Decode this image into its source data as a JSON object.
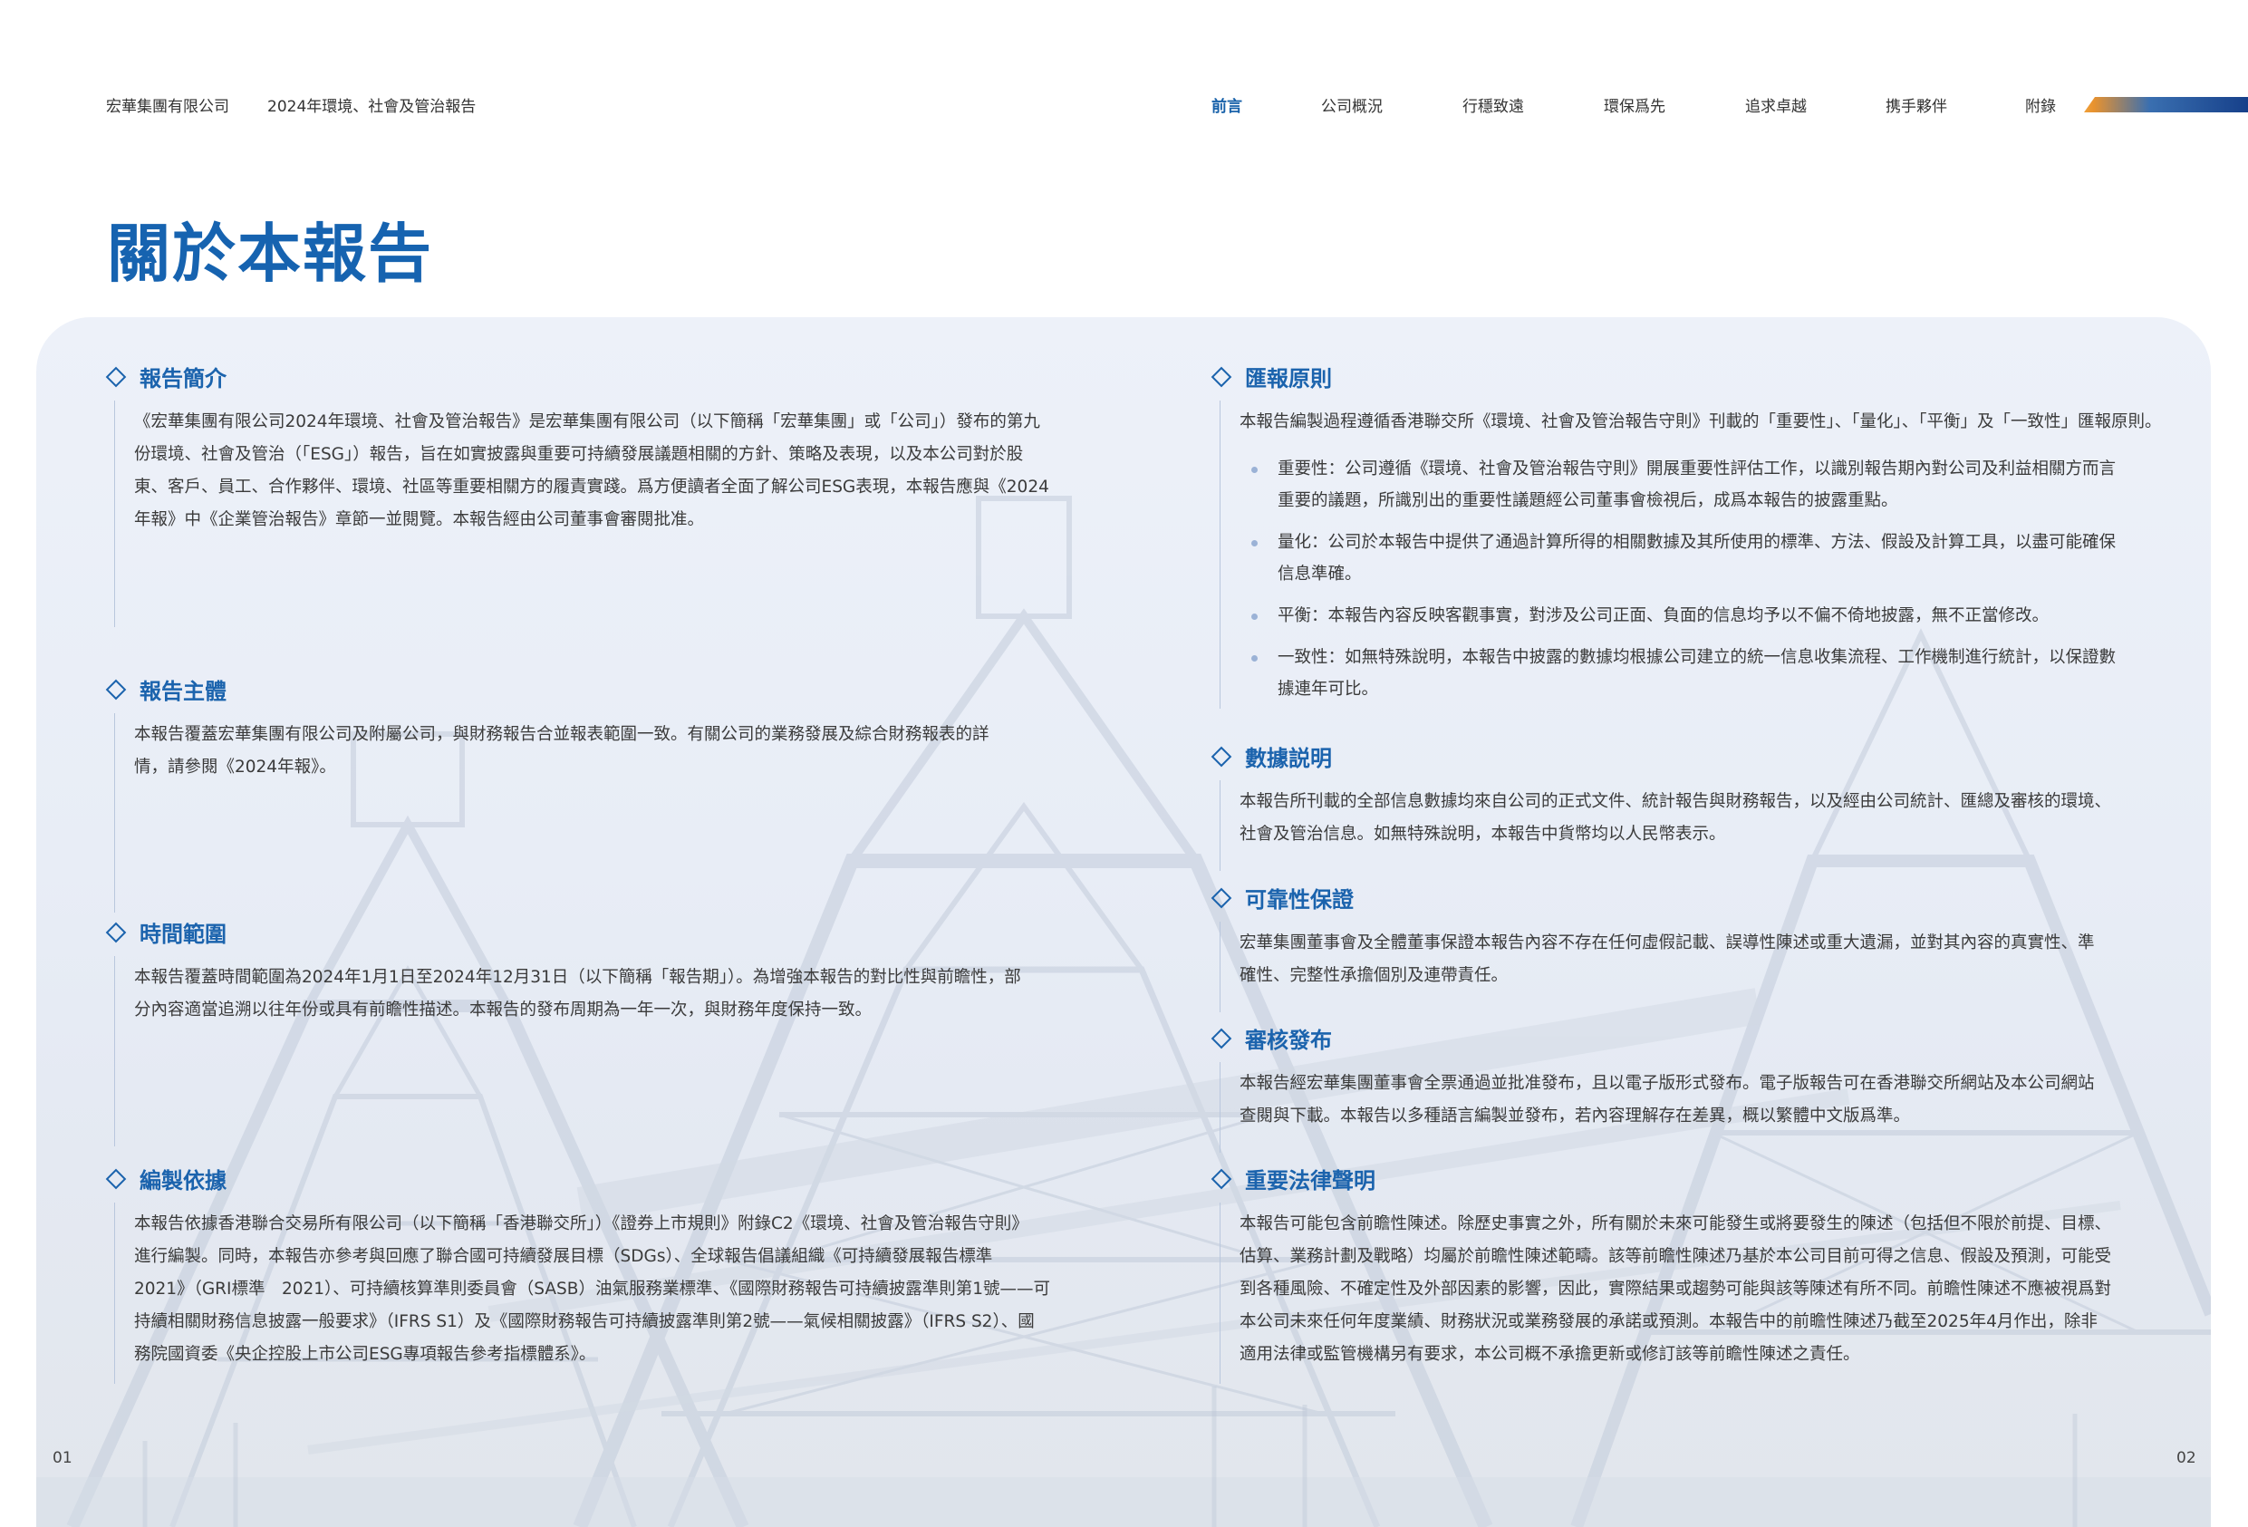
{
  "header": {
    "company": "宏華集團有限公司",
    "report": "2024年環境、社會及管治報告"
  },
  "nav": {
    "items": [
      {
        "label": "前言",
        "active": true
      },
      {
        "label": "公司概況",
        "active": false
      },
      {
        "label": "行穩致遠",
        "active": false
      },
      {
        "label": "環保爲先",
        "active": false
      },
      {
        "label": "追求卓越",
        "active": false
      },
      {
        "label": "携手夥伴",
        "active": false
      },
      {
        "label": "附錄",
        "active": false
      }
    ]
  },
  "page_title": "關於本報告",
  "sections": {
    "intro": {
      "title": "報告簡介",
      "lines": [
        "《宏華集團有限公司2024年環境、社會及管治報告》是宏華集團有限公司（以下簡稱「宏華集團」或「公司」）發布的第九",
        "份環境、社會及管治（「ESG」）報告，旨在如實披露與重要可持續發展議題相關的方針、策略及表現，以及本公司對於股",
        "東、客戶、員工、合作夥伴、環境、社區等重要相關方的履責實踐。爲方便讀者全面了解公司ESG表現，本報告應與《2024",
        "年報》中《企業管治報告》章節一並閱覽。本報告經由公司董事會審閱批准。"
      ]
    },
    "subject": {
      "title": "報告主體",
      "lines": [
        "本報告覆蓋宏華集團有限公司及附屬公司，與財務報告合並報表範圍一致。有關公司的業務發展及綜合財務報表的詳",
        "情，請參閱《2024年報》。"
      ]
    },
    "period": {
      "title": "時間範圍",
      "lines": [
        "本報告覆蓋時間範圍為2024年1月1日至2024年12月31日（以下簡稱「報告期」）。為增強本報告的對比性與前瞻性，部",
        "分內容適當追溯以往年份或具有前瞻性描述。本報告的發布周期為一年一次，與財務年度保持一致。"
      ]
    },
    "basis": {
      "title": "編製依據",
      "lines": [
        "本報告依據香港聯合交易所有限公司（以下簡稱「香港聯交所」）《證券上市規則》附錄C2《環境、社會及管治報告守則》",
        "進行編製。同時，本報告亦參考與回應了聯合國可持續發展目標（SDGs）、全球報告倡議組織《可持續發展報告標準",
        "2021》（GRI標準　2021）、可持續核算準則委員會（SASB）油氣服務業標準、《國際財務報告可持續披露準則第1號——可",
        "持續相關財務信息披露一般要求》（IFRS S1）及《國際財務報告可持續披露準則第2號——氣候相關披露》（IFRS S2）、國",
        "務院國資委《央企控股上市公司ESG專項報告參考指標體系》。"
      ]
    },
    "principles": {
      "title": "匯報原則",
      "intro": "本報告編製過程遵循香港聯交所《環境、社會及管治報告守則》刊載的「重要性」、「量化」、「平衡」及「一致性」匯報原則。",
      "bullets": [
        {
          "lines": [
            "重要性：公司遵循《環境、社會及管治報告守則》開展重要性評估工作，以識別報告期內對公司及利益相關方而言",
            "重要的議題，所識別出的重要性議題經公司董事會檢視后，成爲本報告的披露重點。"
          ]
        },
        {
          "lines": [
            "量化：公司於本報告中提供了通過計算所得的相關數據及其所使用的標準、方法、假設及計算工具，以盡可能確保",
            "信息準確。"
          ]
        },
        {
          "lines": [
            "平衡：本報告內容反映客觀事實，對涉及公司正面、負面的信息均予以不偏不倚地披露，無不正當修改。"
          ]
        },
        {
          "lines": [
            "一致性：如無特殊說明，本報告中披露的數據均根據公司建立的統一信息收集流程、工作機制進行統計，以保證數",
            "據連年可比。"
          ]
        }
      ]
    },
    "data": {
      "title": "數據説明",
      "lines": [
        "本報告所刊載的全部信息數據均來自公司的正式文件、統計報告與財務報告，以及經由公司統計、匯總及審核的環境、",
        "社會及管治信息。如無特殊說明，本報告中貨幣均以人民幣表示。"
      ]
    },
    "reliability": {
      "title": "可靠性保證",
      "lines": [
        "宏華集團董事會及全體董事保證本報告內容不存在任何虛假記載、誤導性陳述或重大遺漏，並對其內容的真實性、準",
        "確性、完整性承擔個別及連帶責任。"
      ]
    },
    "release": {
      "title": "審核發布",
      "lines": [
        "本報告經宏華集團董事會全票通過並批准發布，且以電子版形式發布。電子版報告可在香港聯交所網站及本公司網站",
        "查閱與下載。本報告以多種語言編製並發布，若內容理解存在差異，概以繁體中文版爲準。"
      ]
    },
    "legal": {
      "title": "重要法律聲明",
      "lines": [
        "本報告可能包含前瞻性陳述。除歷史事實之外，所有關於未來可能發生或將要發生的陳述（包括但不限於前提、目標、",
        "估算、業務計劃及戰略）均屬於前瞻性陳述範疇。該等前瞻性陳述乃基於本公司目前可得之信息、假設及預測，可能受",
        "到各種風險、不確定性及外部因素的影響，因此，實際結果或趨勢可能與該等陳述有所不同。前瞻性陳述不應被視爲對",
        "本公司未來任何年度業績、財務狀況或業務發展的承諾或預測。本報告中的前瞻性陳述乃截至2025年4月作出，除非",
        "適用法律或監管機構另有要求，本公司概不承擔更新或修訂該等前瞻性陳述之責任。"
      ]
    }
  },
  "page_numbers": {
    "left": "01",
    "right": "02"
  },
  "colors": {
    "accent": "#1663b0",
    "panel": "#eaeff7",
    "bullet": "#9bb2d6"
  }
}
